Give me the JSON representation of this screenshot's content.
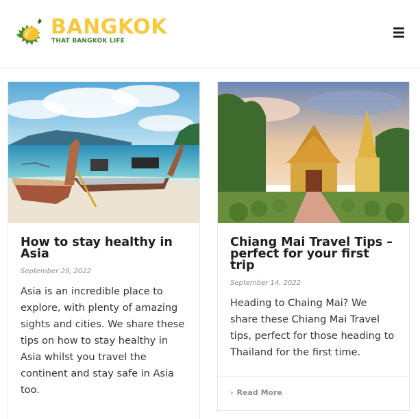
{
  "brand": {
    "title": "BANGKOK",
    "tagline": "THAT BANGKOK LIFE",
    "accent": "#f7c93e",
    "secondary": "#3e7d2e"
  },
  "header": {
    "menu_icon": "hamburger-menu-icon"
  },
  "posts": [
    {
      "title": "How to stay healthy in Asia",
      "date": "September 29, 2022",
      "excerpt": "Asia is an incredible place to explore, with plenty of amazing sights and cities. We share these tips on how to stay healthy in Asia whilst you travel the continent and stay safe in Asia too.",
      "image": "longtail-boats-beach-image"
    },
    {
      "title": "Chiang Mai Travel Tips – perfect for your first trip",
      "date": "September 14, 2022",
      "excerpt": "Heading to Chaing Mai? We share these Chiang Mai Travel tips, perfect for those heading to Thailand for the first time.",
      "image": "chiang-mai-temple-image",
      "read_more": "Read More"
    }
  ]
}
